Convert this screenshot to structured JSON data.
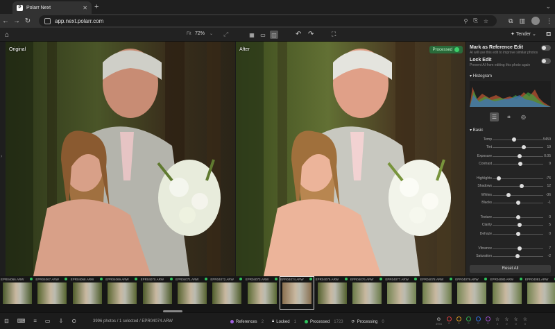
{
  "browser": {
    "tab_title": "Polarr Next",
    "favicon_letter": "P",
    "url": "app.next.polarr.com"
  },
  "appbar": {
    "fit_label": "Fit",
    "zoom_value": "72%",
    "style_label": "Tender"
  },
  "photos": {
    "before_label": "Original",
    "after_label": "After",
    "processed_badge": "Processed"
  },
  "panel": {
    "reference_title": "Mark as Reference Edit",
    "reference_sub": "AI will use this edit to improve similar photos",
    "lock_title": "Lock Edit",
    "lock_sub": "Prevent AI from editing this photo again",
    "histogram_label": "Histogram",
    "basic_label": "Basic",
    "reset_label": "Reset All",
    "sliders": [
      {
        "label": "Temp",
        "value": "5459",
        "pos": 0.42
      },
      {
        "label": "Tint",
        "value": "19",
        "pos": 0.62
      },
      {
        "label": "Exposure",
        "value": "0.05",
        "pos": 0.53
      },
      {
        "label": "Contrast",
        "value": "9",
        "pos": 0.55
      },
      {
        "label": "Highlights",
        "value": "-76",
        "pos": 0.12
      },
      {
        "label": "Shadows",
        "value": "12",
        "pos": 0.58
      },
      {
        "label": "Whites",
        "value": "-36",
        "pos": 0.32
      },
      {
        "label": "Blacks",
        "value": "-1",
        "pos": 0.5
      },
      {
        "label": "Texture",
        "value": "0",
        "pos": 0.5
      },
      {
        "label": "Clarity",
        "value": "5",
        "pos": 0.53
      },
      {
        "label": "Dehaze",
        "value": "0",
        "pos": 0.5
      },
      {
        "label": "Vibrance",
        "value": "7",
        "pos": 0.54
      },
      {
        "label": "Saturation",
        "value": "-2",
        "pos": 0.49
      }
    ]
  },
  "filmstrip": [
    {
      "name": "EPR04066.ARW"
    },
    {
      "name": "EPR04067.ARW"
    },
    {
      "name": "EPR04068.ARW"
    },
    {
      "name": "EPR04069.ARW"
    },
    {
      "name": "EPR04070.ARW"
    },
    {
      "name": "EPR04071.ARW"
    },
    {
      "name": "EPR04072.ARW"
    },
    {
      "name": "EPR04073.ARW"
    },
    {
      "name": "EPR04074.ARW",
      "selected": true
    },
    {
      "name": "EPR04075.ARW"
    },
    {
      "name": "EPR04076.ARW"
    },
    {
      "name": "EPR04077.ARW"
    },
    {
      "name": "EPR04078.ARW"
    },
    {
      "name": "EPR04079.ARW"
    },
    {
      "name": "EPR04080.ARW"
    },
    {
      "name": "EPR04081.ARW"
    }
  ],
  "status": {
    "count_text": "3996 photos / 1 selected / EPR04074.ARW",
    "references_label": "References",
    "references_count": "2",
    "locked_label": "Locked",
    "locked_count": "1",
    "processed_label": "Processed",
    "processed_count": "1723",
    "processing_label": "Processing",
    "processing_count": "0",
    "ratings": [
      {
        "icon": "⊖",
        "num": "3994"
      },
      {
        "icon": "◯",
        "num": "0",
        "color": "#e04040"
      },
      {
        "icon": "◯",
        "num": "0",
        "color": "#e0a020"
      },
      {
        "icon": "◯",
        "num": "0",
        "color": "#30b050"
      },
      {
        "icon": "◯",
        "num": "0",
        "color": "#3070e0"
      },
      {
        "icon": "◯",
        "num": "0",
        "color": "#a050d0"
      },
      {
        "icon": "☆",
        "num": "0"
      },
      {
        "icon": "☆",
        "num": "0"
      },
      {
        "icon": "☆",
        "num": "0"
      },
      {
        "icon": "☆",
        "num": "0"
      }
    ]
  },
  "colors": {
    "accent_green": "#2ec45c",
    "processed_bg": "#2a6a3a"
  }
}
